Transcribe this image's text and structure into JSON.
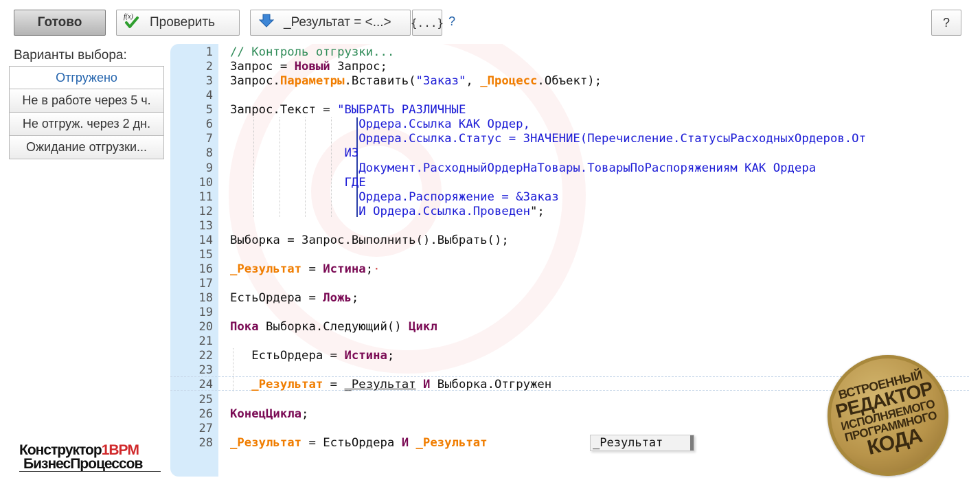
{
  "toolbar": {
    "done_label": "Готово",
    "check_icon": "formula-check-icon",
    "check_label": "Проверить",
    "result_icon": "arrow-down-icon",
    "result_label": "_Результат = <...>",
    "brace_label": "{...}",
    "help_link": "?",
    "help_button": "?"
  },
  "choices": {
    "title": "Варианты выбора:",
    "items": [
      "Отгружено",
      "Не в работе через 5 ч.",
      "Не отгруж. через 2 дн.",
      "Ожидание отгрузки..."
    ]
  },
  "logo": {
    "line1_a": "Конструктор",
    "line1_b": "1BPM",
    "line2": "БизнесПроцессов"
  },
  "editor": {
    "line_numbers": [
      "1",
      "2",
      "3",
      "4",
      "5",
      "6",
      "7",
      "8",
      "9",
      "10",
      "11",
      "12",
      "13",
      "14",
      "15",
      "16",
      "17",
      "18",
      "19",
      "20",
      "21",
      "22",
      "23",
      "24",
      "25",
      "26",
      "27",
      "28"
    ],
    "lines": [
      [
        {
          "t": "cm",
          "v": "// Контроль отгрузки..."
        }
      ],
      [
        {
          "t": "",
          "v": "Запрос = "
        },
        {
          "t": "kw",
          "v": "Новый"
        },
        {
          "t": "",
          "v": " Запрос;"
        }
      ],
      [
        {
          "t": "",
          "v": "Запрос."
        },
        {
          "t": "or",
          "v": "Параметры"
        },
        {
          "t": "",
          "v": ".Вставить("
        },
        {
          "t": "str",
          "v": "\"Заказ\""
        },
        {
          "t": "",
          "v": ", "
        },
        {
          "t": "or",
          "v": "_Процесс"
        },
        {
          "t": "",
          "v": ".Объект);"
        }
      ],
      [],
      [
        {
          "t": "",
          "v": "Запрос.Текст = "
        },
        {
          "t": "str",
          "v": "\"ВЫБРАТЬ РАЗЛИЧНЫЕ"
        }
      ],
      [
        {
          "t": "str",
          "v": "                  Ордера.Ссылка КАК Ордер,"
        }
      ],
      [
        {
          "t": "str",
          "v": "                  Ордера.Ссылка.Статус = ЗНАЧЕНИЕ(Перечисление.СтатусыРасходныхОрдеров.От"
        }
      ],
      [
        {
          "t": "str",
          "v": "                ИЗ"
        }
      ],
      [
        {
          "t": "str",
          "v": "                  Документ.РасходныйОрдерНаТовары.ТоварыПоРаспоряжениям КАК Ордера"
        }
      ],
      [
        {
          "t": "str",
          "v": "                ГДЕ"
        }
      ],
      [
        {
          "t": "str",
          "v": "                  Ордера.Распоряжение = &Заказ"
        }
      ],
      [
        {
          "t": "str",
          "v": "                  И Ордера.Ссылка.Проведен"
        },
        {
          "t": "",
          "v": "\";"
        }
      ],
      [],
      [
        {
          "t": "",
          "v": "Выборка = Запрос.Выполнить().Выбрать();"
        }
      ],
      [],
      [
        {
          "t": "or",
          "v": "_Результат"
        },
        {
          "t": "",
          "v": " = "
        },
        {
          "t": "kw",
          "v": "Истина"
        },
        {
          "t": "",
          "v": ";"
        },
        {
          "t": "dot",
          "v": "·"
        }
      ],
      [],
      [
        {
          "t": "",
          "v": "ЕстьОрдера = "
        },
        {
          "t": "kw",
          "v": "Ложь"
        },
        {
          "t": "",
          "v": ";"
        }
      ],
      [],
      [
        {
          "t": "kw",
          "v": "Пока"
        },
        {
          "t": "",
          "v": " Выборка.Следующий() "
        },
        {
          "t": "kw",
          "v": "Цикл"
        }
      ],
      [],
      [
        {
          "t": "",
          "v": "   ЕстьОрдера = "
        },
        {
          "t": "kw",
          "v": "Истина"
        },
        {
          "t": "",
          "v": ";"
        }
      ],
      [],
      [
        {
          "t": "",
          "v": "   "
        },
        {
          "t": "or",
          "v": "_Результат"
        },
        {
          "t": "",
          "v": " = "
        },
        {
          "t": "ul",
          "v": "_Результат"
        },
        {
          "t": "",
          "v": " "
        },
        {
          "t": "kw",
          "v": "И"
        },
        {
          "t": "",
          "v": " Выборка.Отгружен"
        }
      ],
      [],
      [
        {
          "t": "kw",
          "v": "КонецЦикла"
        },
        {
          "t": "",
          "v": ";"
        }
      ],
      [],
      [
        {
          "t": "or",
          "v": "_Результат"
        },
        {
          "t": "",
          "v": " = ЕстьОрдера "
        },
        {
          "t": "kw",
          "v": "И"
        },
        {
          "t": "",
          "v": " "
        },
        {
          "t": "or",
          "v": "_Результат"
        }
      ]
    ],
    "autocomplete_item": "_Результат"
  },
  "seal": {
    "line1": "ВСТРОЕННЫЙ",
    "line2": "РЕДАКТОР",
    "line3": "ИСПОЛНЯЕМОГО",
    "line4": "ПРОГРАММНОГО",
    "line5": "КОДА"
  }
}
